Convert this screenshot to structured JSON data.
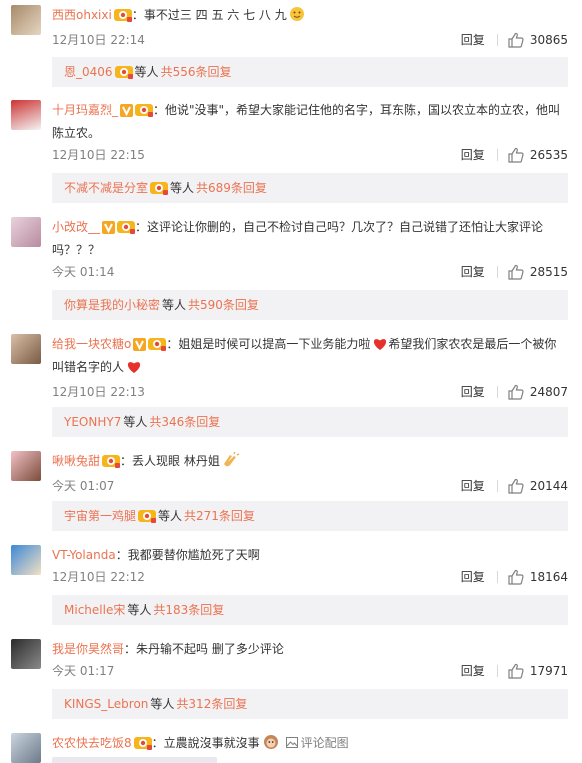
{
  "common": {
    "reply_label": "回复",
    "etc_label": "等人",
    "colors": {
      "link": "#eb7350",
      "muted": "#808080",
      "sub_bg": "#f2f2f5"
    }
  },
  "comments": [
    {
      "user": "西西ohxixi",
      "text": "：事不过三 四 五 六 七 八 九",
      "time": "12月10日 22:14",
      "likes": "30865",
      "sub": {
        "name": "恩_0406",
        "count": "共556条回复"
      }
    },
    {
      "user": "十月玛嘉烈_",
      "text": "：他说\"没事\"，希望大家能记住他的名字，耳东陈，国以农立本的立农，他叫陈立农。",
      "time": "12月10日 22:15",
      "likes": "26535",
      "sub": {
        "name": "不减不减是分室",
        "count": "共689条回复"
      }
    },
    {
      "user": "小改改__",
      "text": "：这评论让你删的，自己不检讨自己吗？几次了？自己说错了还怕让大家评论吗？？？",
      "time": "今天 01:14",
      "likes": "28515",
      "sub": {
        "name": "你算是我的小秘密",
        "count": "共590条回复"
      }
    },
    {
      "user": "给我一块农糖o",
      "text": "：姐姐是时候可以提高一下业务能力啦",
      "text2": "希望我们家农农是最后一个被你叫错名字的人",
      "time": "12月10日 22:13",
      "likes": "24807",
      "sub": {
        "name": "YEONHY7",
        "count": "共346条回复"
      }
    },
    {
      "user": "啾啾兔甜",
      "text": "：丢人现眼 林丹姐",
      "time": "今天 01:07",
      "likes": "20144",
      "sub": {
        "name": "宇宙第一鸡腿",
        "count": "共271条回复"
      }
    },
    {
      "user": "VT-Yolanda",
      "text": "：我都要替你尴尬死了天啊",
      "time": "12月10日 22:12",
      "likes": "18164",
      "sub": {
        "name": "Michelle宋",
        "count": "共183条回复"
      }
    },
    {
      "user": "我是你昊然哥",
      "text": "：朱丹输不起吗 删了多少评论",
      "time": "今天 01:17",
      "likes": "17971",
      "sub": {
        "name": "KINGS_Lebron",
        "count": "共312条回复"
      }
    },
    {
      "user": "农农快去吃饭8",
      "text": "：立農說沒事就沒事",
      "pic_config": "评论配图"
    }
  ]
}
